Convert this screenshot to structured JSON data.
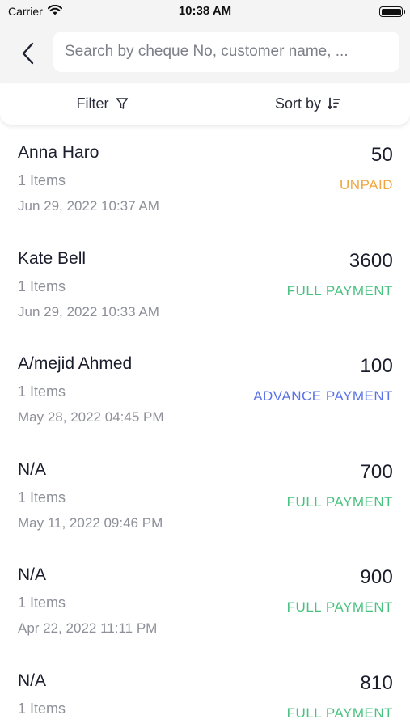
{
  "status_bar": {
    "carrier": "Carrier",
    "time": "10:38 AM"
  },
  "search": {
    "placeholder": "Search by cheque No, customer name, ..."
  },
  "toolbar": {
    "filter_label": "Filter",
    "sort_label": "Sort by"
  },
  "colors": {
    "unpaid": "#f0a640",
    "full_payment": "#48c27f",
    "advance_payment": "#5b73e8"
  },
  "orders": [
    {
      "name": "Anna Haro",
      "items": "1 Items",
      "date": "Jun 29, 2022 10:37 AM",
      "amount": "50",
      "status": "UNPAID"
    },
    {
      "name": "Kate Bell",
      "items": "1 Items",
      "date": "Jun 29, 2022 10:33 AM",
      "amount": "3600",
      "status": "FULL PAYMENT"
    },
    {
      "name": "A/mejid Ahmed",
      "items": "1 Items",
      "date": "May 28, 2022 04:45 PM",
      "amount": "100",
      "status": "ADVANCE PAYMENT"
    },
    {
      "name": "N/A",
      "items": "1 Items",
      "date": "May 11, 2022 09:46 PM",
      "amount": "700",
      "status": "FULL PAYMENT"
    },
    {
      "name": "N/A",
      "items": "1 Items",
      "date": "Apr 22, 2022 11:11 PM",
      "amount": "900",
      "status": "FULL PAYMENT"
    },
    {
      "name": "N/A",
      "items": "1 Items",
      "date": "",
      "amount": "810",
      "status": "FULL PAYMENT"
    }
  ]
}
